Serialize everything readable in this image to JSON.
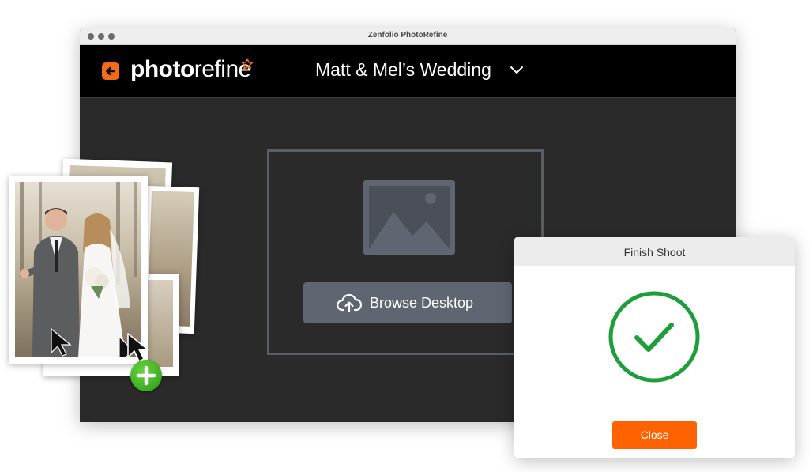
{
  "window": {
    "title": "Zenfolio PhotoRefine"
  },
  "app": {
    "logo_prefix": "photo",
    "logo_suffix": "refine",
    "shoot_title": "Matt & Mel’s Wedding"
  },
  "dropzone": {
    "browse_label": "Browse Desktop"
  },
  "dialog": {
    "title": "Finish Shoot",
    "close_label": "Close"
  },
  "colors": {
    "accent": "#ff6200",
    "success": "#1e9e3a",
    "button_gray": "#5f6672",
    "app_bg": "#2a2a2b"
  },
  "icons": [
    "back-arrow-icon",
    "star-icon",
    "chevron-down-icon",
    "image-placeholder-icon",
    "cloud-upload-icon",
    "plus-icon",
    "cursor-icon",
    "check-circle-icon"
  ]
}
